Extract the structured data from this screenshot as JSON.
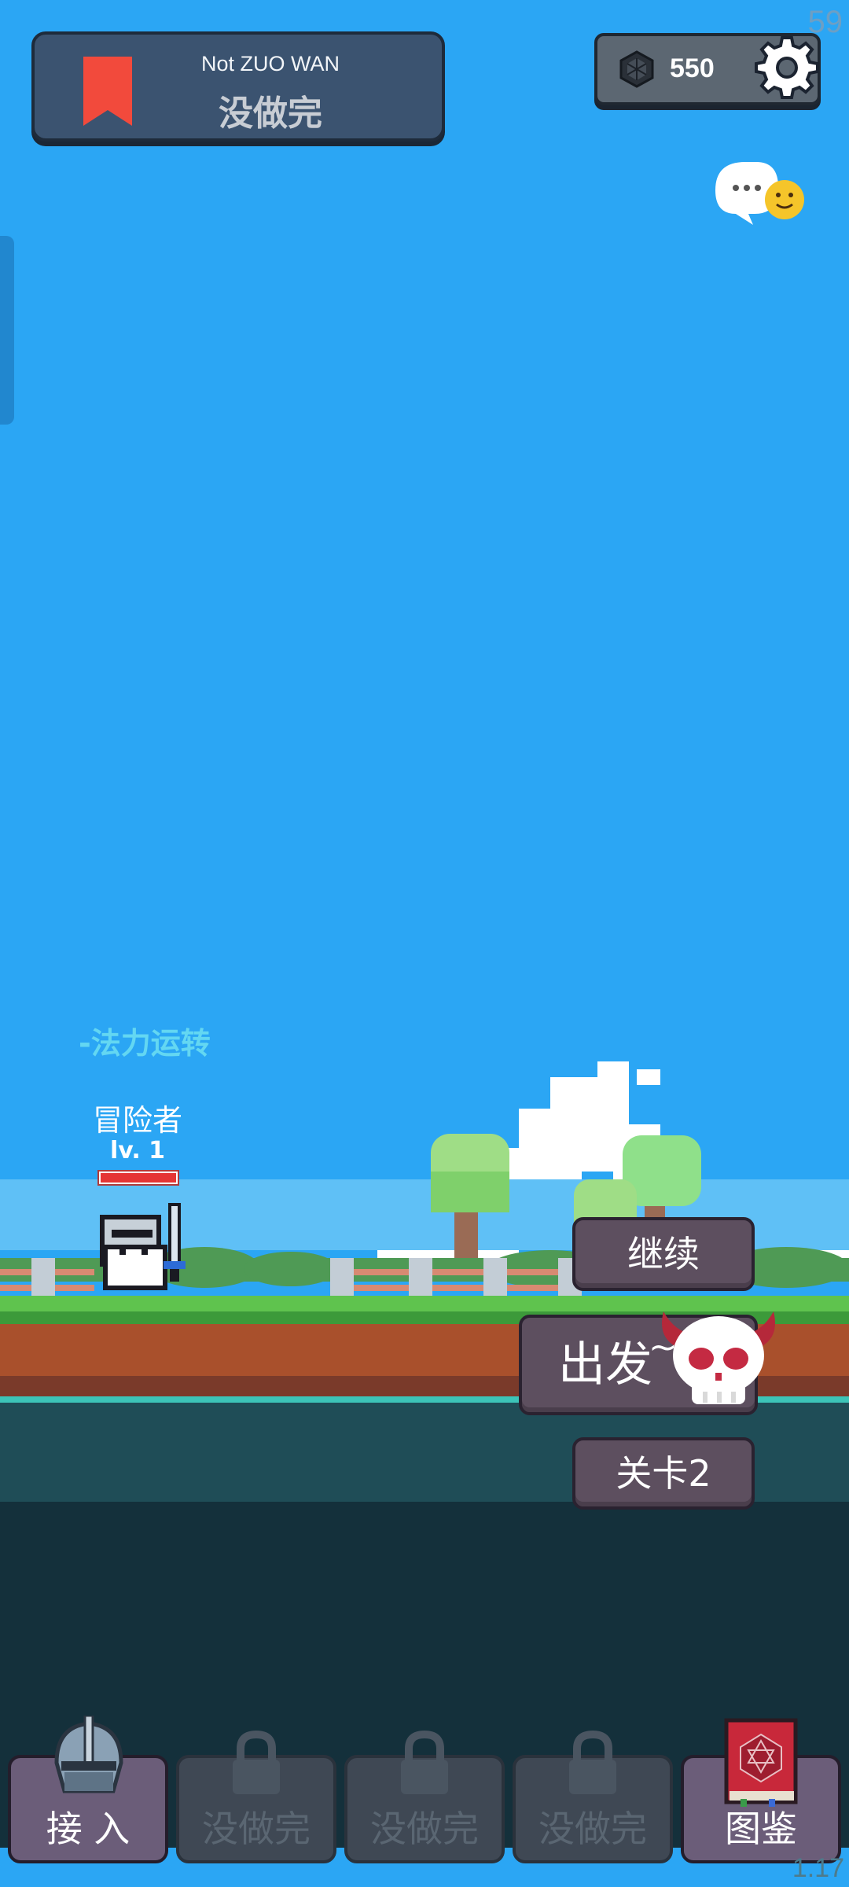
{
  "banner": {
    "subtitle": "Not ZUO WAN",
    "title": "没做完"
  },
  "currency": {
    "amount": "550",
    "icon": "gem-icon"
  },
  "status": {
    "fps": "59",
    "version": "1.17"
  },
  "character": {
    "skill_text": "-法力运转",
    "name": "冒险者",
    "level": "lv. 1",
    "hp_fraction": 1.0
  },
  "actions": {
    "continue": "继续",
    "go": "出发",
    "level": "关卡2"
  },
  "tabs": [
    {
      "label": "接 入",
      "locked": false,
      "icon": "knight-helmet-icon"
    },
    {
      "label": "没做完",
      "locked": true,
      "icon": "lock-icon"
    },
    {
      "label": "没做完",
      "locked": true,
      "icon": "lock-icon"
    },
    {
      "label": "没做完",
      "locked": true,
      "icon": "lock-icon"
    },
    {
      "label": "图鉴",
      "locked": false,
      "icon": "spellbook-icon"
    }
  ],
  "colors": {
    "sky": "#2ba6f4",
    "accent_red": "#f24a3c",
    "skill_text": "#63d7f2"
  }
}
